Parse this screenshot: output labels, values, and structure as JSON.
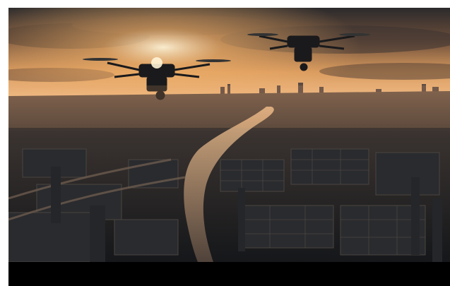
{
  "image": {
    "subject": "drones-over-city-at-sunset",
    "colors": {
      "sky_top": "#2b2a2c",
      "sky_glow": "#f2b26b",
      "sun": "#fff3d6",
      "river": "#d9a777",
      "city_dark": "#1d1f22",
      "bottom_bar": "#000000"
    }
  }
}
